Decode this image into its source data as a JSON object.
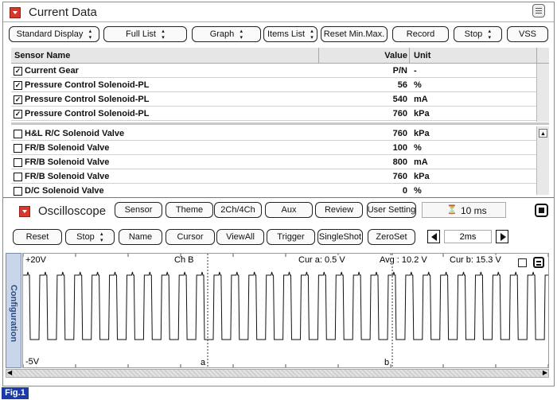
{
  "current_data": {
    "title": "Current Data",
    "toolbar": [
      {
        "label": "Standard Display",
        "updown": true
      },
      {
        "label": "Full List",
        "updown": true
      },
      {
        "label": "Graph",
        "updown": true
      },
      {
        "label": "Items List",
        "updown": true
      },
      {
        "label": "Reset Min.Max.",
        "updown": false
      },
      {
        "label": "Record",
        "updown": false
      },
      {
        "label": "Stop",
        "updown": true
      },
      {
        "label": "VSS",
        "updown": false
      }
    ],
    "columns": {
      "name": "Sensor Name",
      "value": "Value",
      "unit": "Unit"
    },
    "top_rows": [
      {
        "name": "Current Gear",
        "value": "P/N",
        "unit": "-",
        "checked": true
      },
      {
        "name": "Pressure Control Solenoid-PL",
        "value": "56",
        "unit": "%",
        "checked": true
      },
      {
        "name": "Pressure Control Solenoid-PL",
        "value": "540",
        "unit": "mA",
        "checked": true
      },
      {
        "name": "Pressure Control Solenoid-PL",
        "value": "760",
        "unit": "kPa",
        "checked": true
      }
    ],
    "bottom_rows": [
      {
        "name": "H&L R/C Solenoid Valve",
        "value": "760",
        "unit": "kPa",
        "checked": false
      },
      {
        "name": "FR/B Solenoid Valve",
        "value": "100",
        "unit": "%",
        "checked": false
      },
      {
        "name": "FR/B Solenoid Valve",
        "value": "800",
        "unit": "mA",
        "checked": false
      },
      {
        "name": "FR/B Solenoid Valve",
        "value": "760",
        "unit": "kPa",
        "checked": false
      },
      {
        "name": "D/C Solenoid Valve",
        "value": "0",
        "unit": "%",
        "checked": false
      }
    ]
  },
  "oscilloscope": {
    "title": "Oscilloscope",
    "header_buttons": [
      "Sensor",
      "Theme",
      "2Ch/4Ch",
      "Aux",
      "Review",
      "User Setting"
    ],
    "timebase_display": "10 ms",
    "toolbar": [
      {
        "label": "Reset",
        "updown": false
      },
      {
        "label": "Stop",
        "updown": true
      },
      {
        "label": "Name",
        "updown": false
      },
      {
        "label": "Cursor",
        "updown": false
      },
      {
        "label": "ViewAll",
        "updown": false
      },
      {
        "label": "Trigger",
        "updown": false
      },
      {
        "label": "SingleShot",
        "updown": false
      },
      {
        "label": "ZeroSet",
        "updown": false
      }
    ],
    "time_div": "2ms",
    "side_tab": "Configuration",
    "plot": {
      "top_label": "+20V",
      "bottom_label": "-5V",
      "channel": "Ch B",
      "cursor_a": "Cur a: 0.5 V",
      "avg": "Avg : 10.2 V",
      "cursor_b": "Cur b: 15.3 V",
      "marker_a": "a",
      "marker_b": "b"
    }
  },
  "caption": "Fig.1",
  "colors": {
    "accent_red": "#d8382c",
    "caption_bg": "#1a3aa8"
  }
}
